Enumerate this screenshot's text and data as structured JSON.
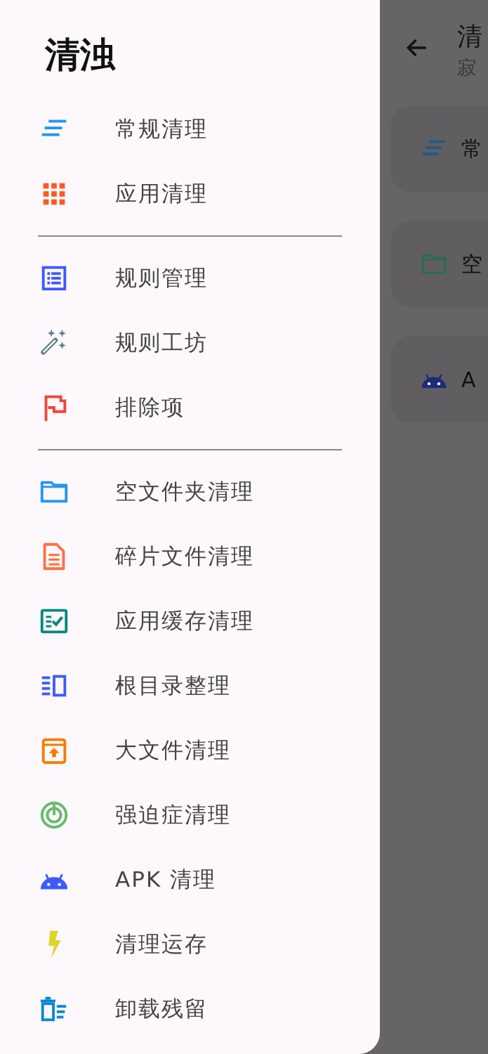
{
  "drawer": {
    "title": "清浊",
    "sections": [
      {
        "items": [
          {
            "label": "常规清理",
            "color": "#2196f3"
          },
          {
            "label": "应用清理",
            "color": "#ff5722"
          }
        ]
      },
      {
        "items": [
          {
            "label": "规则管理",
            "color": "#3d5afe"
          },
          {
            "label": "规则工坊",
            "color": "#607d8b"
          },
          {
            "label": "排除项",
            "color": "#f44336"
          }
        ]
      },
      {
        "items": [
          {
            "label": "空文件夹清理",
            "color": "#2196f3"
          },
          {
            "label": "碎片文件清理",
            "color": "#ff7043"
          },
          {
            "label": "应用缓存清理",
            "color": "#00897b"
          },
          {
            "label": "根目录整理",
            "color": "#3d5afe"
          },
          {
            "label": "大文件清理",
            "color": "#f57c00"
          },
          {
            "label": "强迫症清理",
            "color": "#66bb6a"
          },
          {
            "label": "APK 清理",
            "color": "#3d5afe"
          },
          {
            "label": "清理运存",
            "color": "#e0d32a"
          },
          {
            "label": "卸载残留",
            "color": "#0288d1"
          }
        ]
      }
    ]
  },
  "screen": {
    "title": "清",
    "subtitle": "寂",
    "cards": [
      {
        "label": "常",
        "color": "#1d5a8a"
      },
      {
        "label": "空",
        "color": "#2f6b55"
      },
      {
        "label": "A",
        "color": "#1f2a7a"
      }
    ]
  }
}
